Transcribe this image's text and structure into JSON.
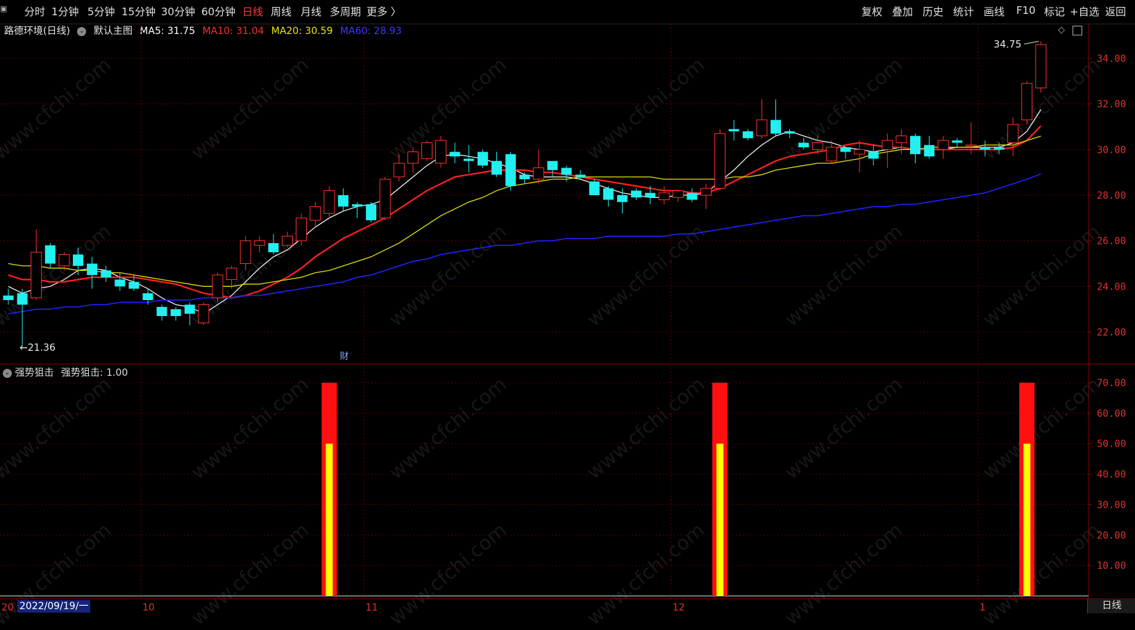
{
  "toolbar": {
    "left": [
      "分时",
      "1分钟",
      "5分钟",
      "15分钟",
      "30分钟",
      "60分钟",
      "日线",
      "周线",
      "月线",
      "多周期",
      "更多 〉"
    ],
    "active": "日线",
    "right": [
      "复权",
      "叠加",
      "历史",
      "统计",
      "画线",
      "F10",
      "标记",
      "+自选",
      "返回"
    ]
  },
  "main_header": {
    "stock": "路德环境(日线)",
    "template": "默认主图",
    "ma5": "MA5: 31.75",
    "ma10": "MA10: 31.04",
    "ma20": "MA20: 30.59",
    "ma60": "MA60: 28.93",
    "colors": {
      "ma5": "#ffffff",
      "ma10": "#ff2a2a",
      "ma20": "#e8e800",
      "ma60": "#2a2aff"
    }
  },
  "sub_header": {
    "name": "强势狙击",
    "value": "强势狙击: 1.00"
  },
  "annotations": {
    "high": "34.75",
    "low": "21.36",
    "fin_marker": "财"
  },
  "x_axis": {
    "labels": [
      {
        "text": "20",
        "i": 0
      },
      {
        "text": "10",
        "i": 10
      },
      {
        "text": "11",
        "i": 26
      },
      {
        "text": "12",
        "i": 48
      },
      {
        "text": "1",
        "i": 70
      }
    ],
    "cursor_date": "2022/09/19/一"
  },
  "period_badge": "日线",
  "icons": {
    "screen": "screen-icon",
    "diamond": "diamond-icon",
    "panel": "panel-toggle-icon",
    "collapse": "collapse-arrow-icon"
  },
  "chart_data": [
    {
      "type": "candlestick",
      "title": "路德环境(日线)",
      "ylim": [
        21,
        35
      ],
      "y_ticks": [
        "22.00",
        "24.00",
        "26.00",
        "28.00",
        "30.00",
        "32.00",
        "34.00"
      ],
      "candles": [
        {
          "o": 23.6,
          "h": 23.9,
          "l": 23.2,
          "c": 23.4
        },
        {
          "o": 23.7,
          "h": 23.9,
          "l": 21.36,
          "c": 23.2
        },
        {
          "o": 23.5,
          "h": 26.5,
          "l": 23.4,
          "c": 25.5
        },
        {
          "o": 25.8,
          "h": 25.9,
          "l": 24.8,
          "c": 25.0
        },
        {
          "o": 24.9,
          "h": 25.5,
          "l": 24.7,
          "c": 25.4
        },
        {
          "o": 25.4,
          "h": 25.7,
          "l": 24.5,
          "c": 24.9
        },
        {
          "o": 25.0,
          "h": 25.3,
          "l": 23.9,
          "c": 24.5
        },
        {
          "o": 24.7,
          "h": 24.9,
          "l": 24.2,
          "c": 24.4
        },
        {
          "o": 24.3,
          "h": 24.6,
          "l": 23.8,
          "c": 24.0
        },
        {
          "o": 24.2,
          "h": 24.5,
          "l": 23.8,
          "c": 23.9
        },
        {
          "o": 23.7,
          "h": 23.9,
          "l": 23.2,
          "c": 23.4
        },
        {
          "o": 23.1,
          "h": 23.2,
          "l": 22.5,
          "c": 22.7
        },
        {
          "o": 23.0,
          "h": 23.1,
          "l": 22.5,
          "c": 22.7
        },
        {
          "o": 23.2,
          "h": 23.3,
          "l": 22.3,
          "c": 22.8
        },
        {
          "o": 22.4,
          "h": 23.3,
          "l": 22.3,
          "c": 23.2
        },
        {
          "o": 23.5,
          "h": 24.6,
          "l": 23.3,
          "c": 24.5
        },
        {
          "o": 24.3,
          "h": 24.9,
          "l": 23.9,
          "c": 24.8
        },
        {
          "o": 25.0,
          "h": 26.2,
          "l": 24.7,
          "c": 26.0
        },
        {
          "o": 25.8,
          "h": 26.2,
          "l": 25.5,
          "c": 26.0
        },
        {
          "o": 25.9,
          "h": 26.3,
          "l": 25.4,
          "c": 25.5
        },
        {
          "o": 25.8,
          "h": 26.4,
          "l": 25.7,
          "c": 26.2
        },
        {
          "o": 26.0,
          "h": 27.2,
          "l": 25.8,
          "c": 27.0
        },
        {
          "o": 26.9,
          "h": 27.7,
          "l": 26.6,
          "c": 27.5
        },
        {
          "o": 27.2,
          "h": 28.4,
          "l": 27.0,
          "c": 28.2
        },
        {
          "o": 28.0,
          "h": 28.3,
          "l": 27.3,
          "c": 27.5
        },
        {
          "o": 27.6,
          "h": 27.7,
          "l": 27.0,
          "c": 27.5
        },
        {
          "o": 27.6,
          "h": 27.7,
          "l": 26.8,
          "c": 26.9
        },
        {
          "o": 27.0,
          "h": 28.8,
          "l": 26.9,
          "c": 28.7
        },
        {
          "o": 28.8,
          "h": 29.8,
          "l": 28.6,
          "c": 29.4
        },
        {
          "o": 29.4,
          "h": 30.1,
          "l": 29.0,
          "c": 29.9
        },
        {
          "o": 29.6,
          "h": 30.4,
          "l": 29.5,
          "c": 30.3
        },
        {
          "o": 29.4,
          "h": 30.6,
          "l": 29.2,
          "c": 30.4
        },
        {
          "o": 29.9,
          "h": 30.3,
          "l": 29.4,
          "c": 29.7
        },
        {
          "o": 29.6,
          "h": 30.2,
          "l": 29.0,
          "c": 29.5
        },
        {
          "o": 29.9,
          "h": 30.0,
          "l": 29.2,
          "c": 29.3
        },
        {
          "o": 29.5,
          "h": 29.9,
          "l": 28.8,
          "c": 28.9
        },
        {
          "o": 29.8,
          "h": 29.9,
          "l": 28.2,
          "c": 28.4
        },
        {
          "o": 28.9,
          "h": 29.0,
          "l": 28.5,
          "c": 28.7
        },
        {
          "o": 28.7,
          "h": 30.0,
          "l": 28.5,
          "c": 29.2
        },
        {
          "o": 29.5,
          "h": 29.5,
          "l": 28.8,
          "c": 29.1
        },
        {
          "o": 29.2,
          "h": 29.3,
          "l": 28.6,
          "c": 28.9
        },
        {
          "o": 28.9,
          "h": 29.1,
          "l": 28.7,
          "c": 28.8
        },
        {
          "o": 28.6,
          "h": 28.7,
          "l": 28.0,
          "c": 28.0
        },
        {
          "o": 28.3,
          "h": 28.4,
          "l": 27.5,
          "c": 27.8
        },
        {
          "o": 28.0,
          "h": 28.3,
          "l": 27.2,
          "c": 27.7
        },
        {
          "o": 28.2,
          "h": 28.3,
          "l": 27.8,
          "c": 27.9
        },
        {
          "o": 28.1,
          "h": 28.4,
          "l": 27.6,
          "c": 27.9
        },
        {
          "o": 27.8,
          "h": 28.4,
          "l": 27.6,
          "c": 28.1
        },
        {
          "o": 27.9,
          "h": 28.2,
          "l": 27.7,
          "c": 28.2
        },
        {
          "o": 28.1,
          "h": 28.3,
          "l": 27.7,
          "c": 27.8
        },
        {
          "o": 28.0,
          "h": 28.5,
          "l": 27.4,
          "c": 28.3
        },
        {
          "o": 28.3,
          "h": 30.9,
          "l": 28.2,
          "c": 30.7
        },
        {
          "o": 30.9,
          "h": 31.3,
          "l": 30.4,
          "c": 30.8
        },
        {
          "o": 30.8,
          "h": 30.9,
          "l": 30.4,
          "c": 30.5
        },
        {
          "o": 30.6,
          "h": 32.2,
          "l": 30.5,
          "c": 31.3
        },
        {
          "o": 31.3,
          "h": 32.2,
          "l": 30.6,
          "c": 30.7
        },
        {
          "o": 30.8,
          "h": 30.9,
          "l": 30.5,
          "c": 30.7
        },
        {
          "o": 30.3,
          "h": 30.5,
          "l": 30.0,
          "c": 30.1
        },
        {
          "o": 30.0,
          "h": 30.6,
          "l": 29.8,
          "c": 30.3
        },
        {
          "o": 29.5,
          "h": 30.4,
          "l": 29.4,
          "c": 30.1
        },
        {
          "o": 30.1,
          "h": 30.1,
          "l": 29.6,
          "c": 29.9
        },
        {
          "o": 29.8,
          "h": 30.4,
          "l": 29.0,
          "c": 30.0
        },
        {
          "o": 29.9,
          "h": 30.2,
          "l": 29.3,
          "c": 29.6
        },
        {
          "o": 30.0,
          "h": 30.7,
          "l": 29.2,
          "c": 30.4
        },
        {
          "o": 30.3,
          "h": 30.9,
          "l": 29.8,
          "c": 30.6
        },
        {
          "o": 30.6,
          "h": 30.7,
          "l": 29.4,
          "c": 29.8
        },
        {
          "o": 30.2,
          "h": 30.6,
          "l": 29.6,
          "c": 29.7
        },
        {
          "o": 30.0,
          "h": 30.6,
          "l": 29.6,
          "c": 30.4
        },
        {
          "o": 30.4,
          "h": 30.5,
          "l": 30.1,
          "c": 30.3
        },
        {
          "o": 30.2,
          "h": 31.2,
          "l": 29.8,
          "c": 30.2
        },
        {
          "o": 30.1,
          "h": 30.4,
          "l": 29.7,
          "c": 30.0
        },
        {
          "o": 30.1,
          "h": 30.3,
          "l": 29.8,
          "c": 30.0
        },
        {
          "o": 30.3,
          "h": 31.4,
          "l": 29.7,
          "c": 31.1
        },
        {
          "o": 31.3,
          "h": 33.0,
          "l": 31.1,
          "c": 32.9
        },
        {
          "o": 32.7,
          "h": 34.75,
          "l": 32.5,
          "c": 34.6
        }
      ],
      "series": [
        {
          "name": "MA5",
          "values": [
            24.0,
            23.7,
            23.9,
            24.0,
            24.3,
            24.7,
            24.8,
            24.7,
            24.4,
            24.2,
            23.9,
            23.5,
            23.2,
            23.1,
            22.8,
            23.2,
            23.6,
            24.2,
            24.8,
            25.3,
            25.6,
            26.1,
            26.6,
            27.0,
            27.3,
            27.5,
            27.6,
            27.8,
            28.3,
            28.8,
            29.3,
            29.7,
            29.8,
            29.7,
            29.6,
            29.4,
            29.2,
            28.9,
            28.8,
            28.8,
            28.8,
            28.7,
            28.5,
            28.3,
            28.1,
            28.0,
            27.9,
            27.9,
            28.0,
            28.0,
            28.1,
            28.6,
            29.1,
            29.7,
            30.2,
            30.6,
            30.8,
            30.6,
            30.4,
            30.3,
            30.1,
            30.0,
            29.9,
            30.0,
            30.1,
            30.0,
            30.0,
            30.0,
            30.1,
            30.1,
            30.1,
            30.1,
            30.3,
            30.8,
            31.75
          ]
        },
        {
          "name": "MA10",
          "values": [
            24.5,
            24.3,
            24.3,
            24.2,
            24.2,
            24.3,
            24.4,
            24.4,
            24.4,
            24.4,
            24.3,
            24.2,
            24.1,
            23.9,
            23.7,
            23.6,
            23.5,
            23.6,
            23.8,
            24.1,
            24.4,
            24.8,
            25.3,
            25.7,
            26.1,
            26.4,
            26.7,
            27.0,
            27.4,
            27.8,
            28.2,
            28.5,
            28.8,
            28.9,
            29.0,
            29.1,
            29.1,
            29.1,
            29.0,
            29.0,
            28.9,
            28.8,
            28.7,
            28.6,
            28.5,
            28.4,
            28.3,
            28.2,
            28.2,
            28.1,
            28.1,
            28.3,
            28.6,
            28.9,
            29.2,
            29.5,
            29.7,
            29.8,
            29.9,
            30.0,
            30.2,
            30.3,
            30.2,
            30.1,
            30.1,
            30.0,
            30.0,
            30.0,
            30.0,
            30.0,
            30.0,
            30.0,
            30.1,
            30.4,
            31.04
          ]
        },
        {
          "name": "MA20",
          "values": [
            25.0,
            24.9,
            24.9,
            24.8,
            24.8,
            24.7,
            24.7,
            24.6,
            24.6,
            24.5,
            24.4,
            24.3,
            24.2,
            24.1,
            24.0,
            24.0,
            24.0,
            24.1,
            24.1,
            24.2,
            24.3,
            24.4,
            24.6,
            24.7,
            24.9,
            25.1,
            25.3,
            25.6,
            25.9,
            26.3,
            26.7,
            27.1,
            27.4,
            27.7,
            27.9,
            28.2,
            28.4,
            28.5,
            28.6,
            28.7,
            28.7,
            28.8,
            28.8,
            28.8,
            28.8,
            28.8,
            28.8,
            28.7,
            28.7,
            28.7,
            28.7,
            28.7,
            28.8,
            28.8,
            28.9,
            29.1,
            29.2,
            29.3,
            29.4,
            29.4,
            29.5,
            29.6,
            29.8,
            29.9,
            30.0,
            30.0,
            30.1,
            30.1,
            30.1,
            30.1,
            30.2,
            30.2,
            30.2,
            30.4,
            30.59
          ]
        },
        {
          "name": "MA60",
          "values": [
            22.8,
            22.9,
            23.0,
            23.0,
            23.1,
            23.1,
            23.2,
            23.2,
            23.3,
            23.3,
            23.3,
            23.4,
            23.4,
            23.4,
            23.5,
            23.5,
            23.5,
            23.6,
            23.6,
            23.7,
            23.8,
            23.9,
            24.0,
            24.1,
            24.2,
            24.4,
            24.5,
            24.7,
            24.9,
            25.1,
            25.2,
            25.4,
            25.5,
            25.6,
            25.7,
            25.8,
            25.8,
            25.9,
            26.0,
            26.0,
            26.1,
            26.1,
            26.1,
            26.2,
            26.2,
            26.2,
            26.2,
            26.2,
            26.3,
            26.3,
            26.4,
            26.5,
            26.6,
            26.7,
            26.8,
            26.9,
            27.0,
            27.1,
            27.1,
            27.2,
            27.3,
            27.4,
            27.5,
            27.5,
            27.6,
            27.6,
            27.7,
            27.8,
            27.9,
            28.0,
            28.1,
            28.3,
            28.5,
            28.7,
            28.93
          ]
        }
      ]
    },
    {
      "type": "bar",
      "title": "强势狙击",
      "ylim": [
        0,
        75
      ],
      "y_ticks": [
        "10.00",
        "20.00",
        "30.00",
        "40.00",
        "50.00",
        "60.00",
        "70.00"
      ],
      "signals": [
        {
          "i": 23,
          "outer": 70,
          "inner": 50
        },
        {
          "i": 51,
          "outer": 70,
          "inner": 50
        },
        {
          "i": 73,
          "outer": 70,
          "inner": 50
        }
      ]
    }
  ]
}
